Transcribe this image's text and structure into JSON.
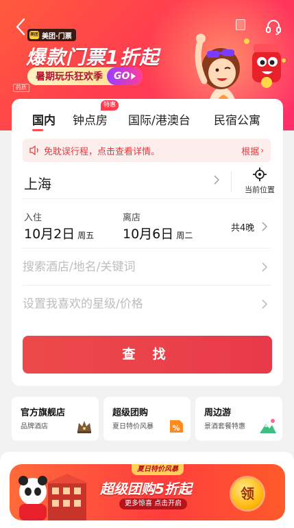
{
  "header": {
    "brand_label": "美团·门票",
    "brand_logo_text": "美团",
    "headline": "爆款门票1折起",
    "promo_text": "暑期玩乐狂欢季",
    "promo_go": "GO",
    "ad_label": "药质"
  },
  "tabs": [
    {
      "label": "国内",
      "active": true
    },
    {
      "label": "钟点房",
      "badge": "特惠"
    },
    {
      "label": "国际/港澳台"
    },
    {
      "label": "民宿公寓"
    }
  ],
  "notice": {
    "text": "免耽误行程，点击查看详情。",
    "more": "根据"
  },
  "city": {
    "value": "上海",
    "locate_label": "当前位置"
  },
  "dates": {
    "checkin_label": "入住",
    "checkin_date": "10月2日",
    "checkin_weekday": "周五",
    "checkout_label": "离店",
    "checkout_date": "10月6日",
    "checkout_weekday": "周二",
    "nights": "共4晚"
  },
  "search": {
    "keyword_placeholder": "搜索酒店/地名/关键词",
    "star_placeholder": "设置我喜欢的星级/价格",
    "button_label": "查 找"
  },
  "features": [
    {
      "title": "官方旗舰店",
      "subtitle": "品牌酒店",
      "icon": "crown-icon"
    },
    {
      "title": "超级团购",
      "subtitle": "夏日特价风暴",
      "icon": "discount-tag-icon"
    },
    {
      "title": "周边游",
      "subtitle": "景酒套餐特惠",
      "icon": "mountain-icon"
    }
  ],
  "banner": {
    "tag": "夏日特价风暴",
    "title": "超级团购5折起",
    "subtitle": "更多惊喜 点击开启",
    "coin": "领"
  },
  "colors": {
    "primary": "#ec4a4a",
    "notice_bg": "#fdeeee",
    "hero_start": "#ff5b3c",
    "hero_end": "#ff2d6a"
  }
}
